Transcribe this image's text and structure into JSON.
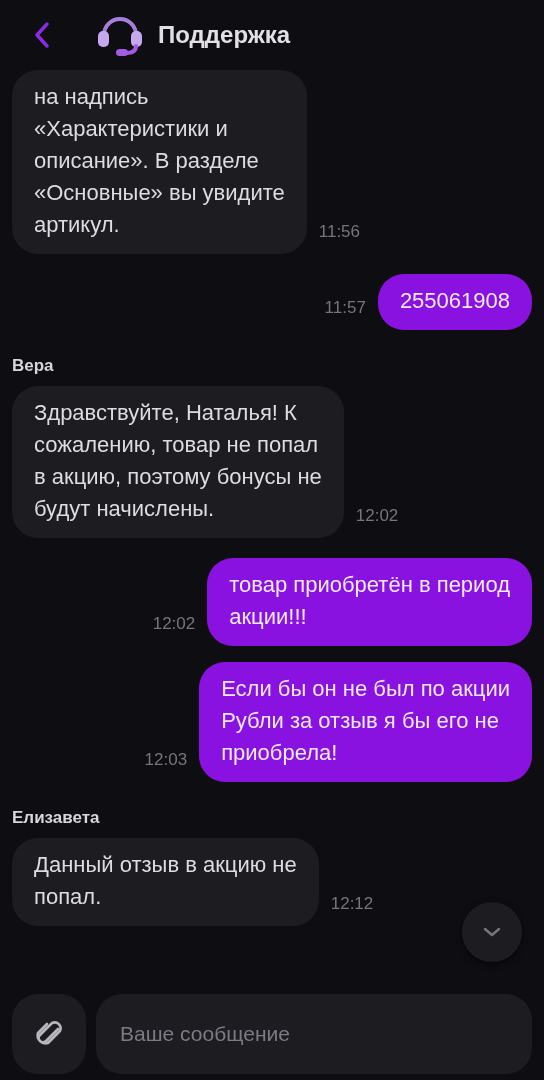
{
  "header": {
    "title": "Поддержка"
  },
  "messages": [
    {
      "kind": "incoming",
      "text": "на надпись\n«Характеристики и\nописание». В разделе\n«Основные» вы увидите\nартикул.",
      "time": "11:56"
    },
    {
      "kind": "outgoing",
      "text": "255061908",
      "time": "11:57"
    },
    {
      "kind": "incoming",
      "sender": "Вера",
      "text": "Здравствуйте, Наталья! К\nсожалению, товар не попал\nв акцию, поэтому бонусы не\nбудут начислены.",
      "time": "12:02"
    },
    {
      "kind": "outgoing",
      "text": "товар приобретён в период\nакции!!!",
      "time": "12:02"
    },
    {
      "kind": "outgoing",
      "text": "Если бы он не был по акции\nРубли за отзыв я бы его не\nприобрела!",
      "time": "12:03"
    },
    {
      "kind": "incoming",
      "sender": "Елизавета",
      "text": "Данный отзыв в акцию не\nпопал.",
      "time": "12:12"
    }
  ],
  "composer": {
    "placeholder": "Ваше сообщение"
  }
}
